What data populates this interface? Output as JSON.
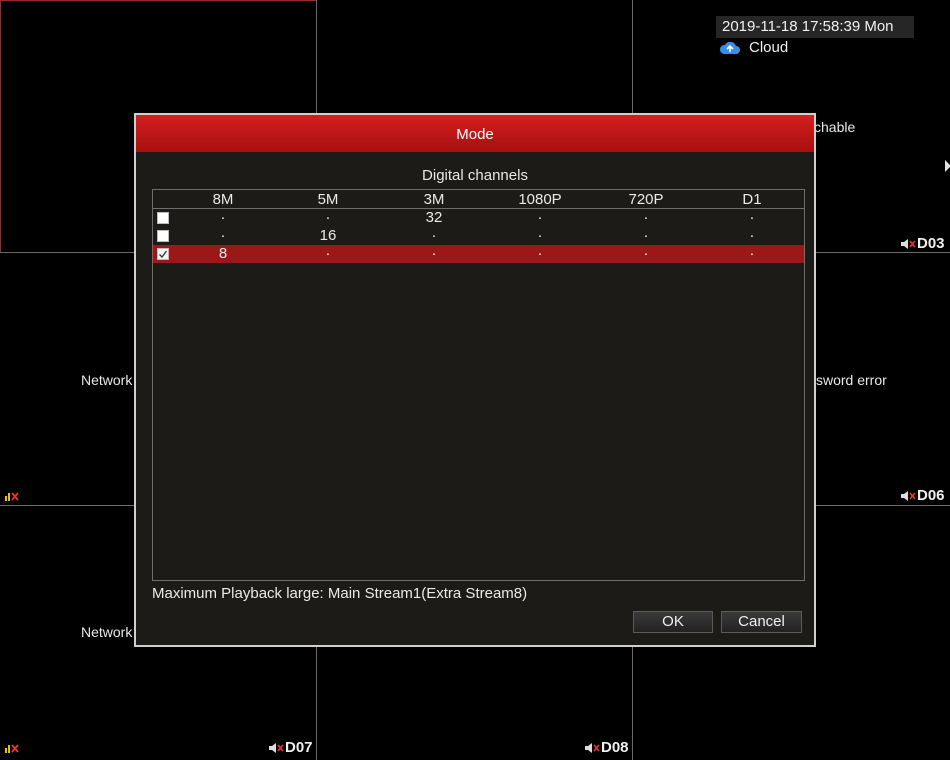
{
  "header": {
    "datetime": "2019-11-18 17:58:39 Mon",
    "cloud_label": "Cloud"
  },
  "cells": {
    "top_right_status": "chable",
    "mid_left_status": "Network",
    "mid_right_status": "sword error",
    "bottom_left_status": "Network"
  },
  "channels": {
    "d03": "D03",
    "d06": "D06",
    "d07": "D07",
    "d08": "D08"
  },
  "dialog": {
    "title": "Mode",
    "section_title": "Digital channels",
    "columns": [
      "8M",
      "5M",
      "3M",
      "1080P",
      "720P",
      "D1"
    ],
    "rows": [
      {
        "checked": false,
        "selected": false,
        "values": [
          ".",
          ".",
          "32",
          ".",
          ".",
          "."
        ]
      },
      {
        "checked": false,
        "selected": false,
        "values": [
          ".",
          "16",
          ".",
          ".",
          ".",
          "."
        ]
      },
      {
        "checked": true,
        "selected": true,
        "values": [
          "8",
          ".",
          ".",
          ".",
          ".",
          "."
        ]
      }
    ],
    "note": "Maximum Playback large: Main Stream1(Extra Stream8)",
    "ok_label": "OK",
    "cancel_label": "Cancel"
  },
  "colors": {
    "title_bar": "#c81818",
    "selected_row": "#9c1818",
    "dialog_bg": "#1c1b17"
  }
}
